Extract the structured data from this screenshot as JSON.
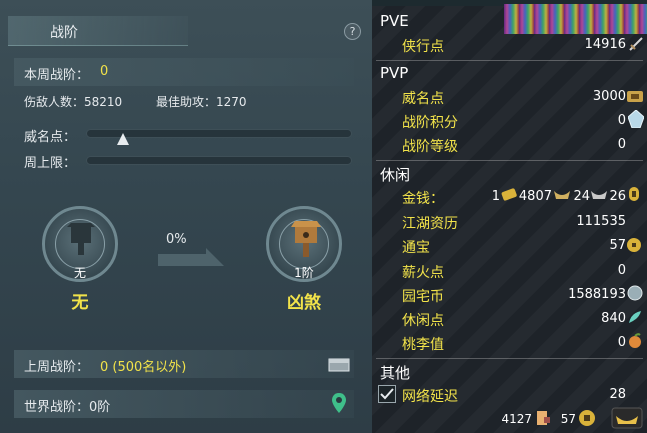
{
  "left": {
    "title": "战阶",
    "help": "?",
    "current_rank_label": "本周战阶：",
    "current_rank_value": "0",
    "kills_label": "伤敌人数：58210",
    "assists_label": "最佳助攻：1270",
    "prestige_label": "威名点：",
    "weekly_cap_label": "周上限：",
    "prestige_progress": 0.14,
    "current_medal": {
      "level": "无",
      "name": "无"
    },
    "progress_text": "0%",
    "next_medal": {
      "level": "1阶",
      "name": "凶煞"
    },
    "last_week_label": "上周战阶：",
    "last_week_value": "0 (500名以外)",
    "world_rank_label": "世界战阶：0阶"
  },
  "right": {
    "pve": {
      "title": "PVE",
      "rows": [
        {
          "label": "侠行点",
          "value": "14916",
          "icon": "sword-icon"
        }
      ]
    },
    "pvp": {
      "title": "PVP",
      "rows": [
        {
          "label": "威名点",
          "value": "3000",
          "icon": "prestige-icon"
        },
        {
          "label": "战阶积分",
          "value": "0",
          "icon": "crystal-icon"
        },
        {
          "label": "战阶等级",
          "value": "0"
        }
      ]
    },
    "leisure": {
      "title": "休闲",
      "money_label": "金钱：",
      "money": {
        "gold": "1",
        "silver": "4807",
        "copper": "24",
        "coin": "26"
      },
      "rows": [
        {
          "label": "江湖资历",
          "value": "111535"
        },
        {
          "label": "通宝",
          "value": "57",
          "icon": "coin-icon"
        },
        {
          "label": "薪火点",
          "value": "0"
        },
        {
          "label": "园宅币",
          "value": "1588193",
          "icon": "house-coin-icon"
        },
        {
          "label": "休闲点",
          "value": "840",
          "icon": "feather-icon"
        },
        {
          "label": "桃李值",
          "value": "0",
          "icon": "peach-icon"
        }
      ]
    },
    "other": {
      "title": "其他",
      "latency_label": "网络延迟",
      "latency_value": "28"
    },
    "footer": {
      "value_a": "4127",
      "value_b": "57"
    }
  },
  "colors": {
    "accent": "#f2e34a",
    "panel": "#34464f",
    "divider": "#6f8890"
  }
}
